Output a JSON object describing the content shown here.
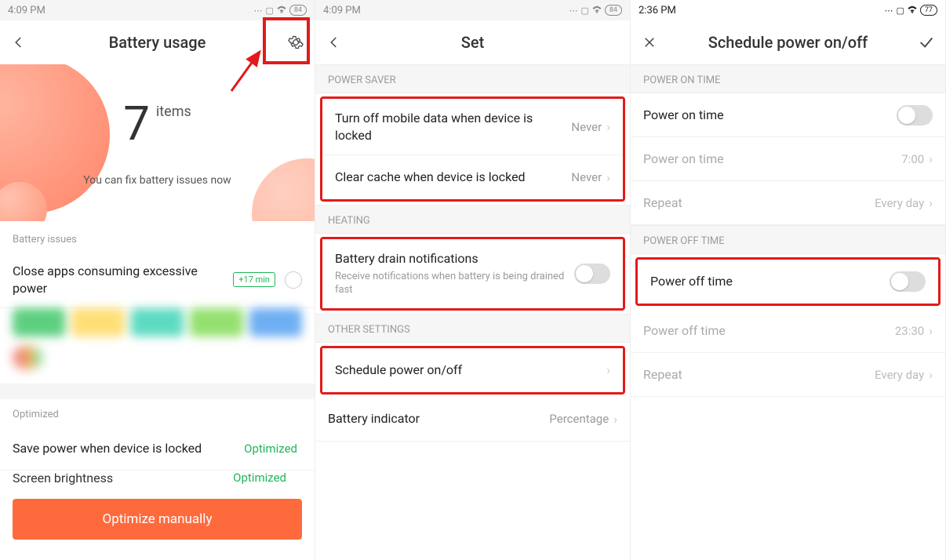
{
  "panel1": {
    "status_time": "4:09 PM",
    "battery_pct": "84",
    "nav_title": "Battery usage",
    "items_number": "7",
    "items_label": "items",
    "items_sub": "You can fix battery issues now",
    "section_issues": "Battery issues",
    "close_apps_label": "Close apps consuming excessive power",
    "close_apps_badge": "+17 min",
    "section_optimized": "Optimized",
    "save_power_label": "Save power when device is locked",
    "save_power_value": "Optimized",
    "brightness_label": "Screen brightness",
    "brightness_value": "Optimized",
    "optimize_btn": "Optimize manually"
  },
  "panel2": {
    "status_time": "4:09 PM",
    "battery_pct": "84",
    "nav_title": "Set",
    "section_power_saver": "POWER SAVER",
    "mobile_data_label": "Turn off mobile data when device is locked",
    "mobile_data_value": "Never",
    "clear_cache_label": "Clear cache when device is locked",
    "clear_cache_value": "Never",
    "section_heating": "HEATING",
    "drain_label": "Battery drain notifications",
    "drain_sub": "Receive notifications when battery is being drained fast",
    "section_other": "OTHER SETTINGS",
    "schedule_label": "Schedule power on/off",
    "indicator_label": "Battery indicator",
    "indicator_value": "Percentage"
  },
  "panel3": {
    "status_time": "2:36 PM",
    "battery_pct": "77",
    "nav_title": "Schedule power on/off",
    "section_on": "POWER ON TIME",
    "on_toggle_label": "Power on time",
    "on_time_label": "Power on time",
    "on_time_value": "7:00",
    "on_repeat_label": "Repeat",
    "on_repeat_value": "Every day",
    "section_off": "POWER OFF TIME",
    "off_toggle_label": "Power off time",
    "off_time_label": "Power off time",
    "off_time_value": "23:30",
    "off_repeat_label": "Repeat",
    "off_repeat_value": "Every day"
  }
}
